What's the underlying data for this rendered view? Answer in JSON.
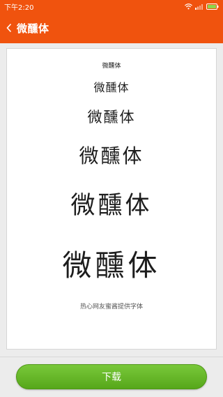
{
  "status_bar": {
    "time": "下午2:20",
    "icons": [
      "wifi-icon",
      "signal-icon",
      "battery-icon"
    ]
  },
  "header": {
    "back_icon": "chevron-left-icon",
    "title": "微醺体",
    "background_color": "#f0530e"
  },
  "preview": {
    "samples": [
      "微醺体",
      "微醺体",
      "微醺体",
      "微醺体",
      "微醺体",
      "微醺体"
    ],
    "credit": "热心网友蜜酱提供字体"
  },
  "footer": {
    "download_label": "下载",
    "button_color": "#62b526"
  }
}
